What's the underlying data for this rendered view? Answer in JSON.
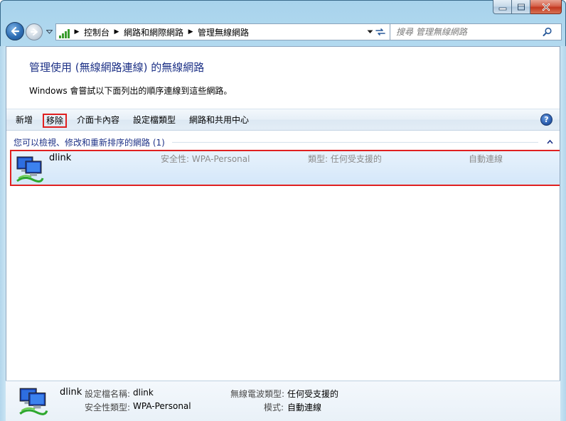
{
  "window": {
    "minimize_icon": "minimize-icon",
    "maximize_icon": "maximize-icon",
    "close_icon": "close-icon"
  },
  "address_bar": {
    "breadcrumbs": [
      "控制台",
      "網路和網際網路",
      "管理無線網路"
    ],
    "search_placeholder": "搜尋 管理無線網路"
  },
  "page": {
    "heading": "管理使用 (無線網路連線) 的無線網路",
    "description": "Windows 會嘗試以下面列出的順序連線到這些網路。"
  },
  "toolbar": {
    "items": [
      "新增",
      "移除",
      "介面卡內容",
      "設定檔類型",
      "網路和共用中心"
    ],
    "highlighted": "移除",
    "help_icon": "help-icon"
  },
  "network_list": {
    "group_title": "您可以檢視、修改和重新排序的網路 (1)",
    "networks": [
      {
        "name": "dlink",
        "security": "安全性: WPA-Personal",
        "type": "類型: 任何受支援的",
        "mode": "自動連線"
      }
    ]
  },
  "details_pane": {
    "name": "dlink",
    "profile_name_label": "設定檔名稱:",
    "profile_name_value": "dlink",
    "security_type_label": "安全性類型:",
    "security_type_value": "WPA-Personal",
    "radio_type_label": "無線電波類型:",
    "radio_type_value": "任何受支援的",
    "mode_label": "模式:",
    "mode_value": "自動連線"
  },
  "colors": {
    "highlight_border": "#e02020",
    "link_blue": "#1e3287",
    "selected_row": "#d4e7f9"
  }
}
